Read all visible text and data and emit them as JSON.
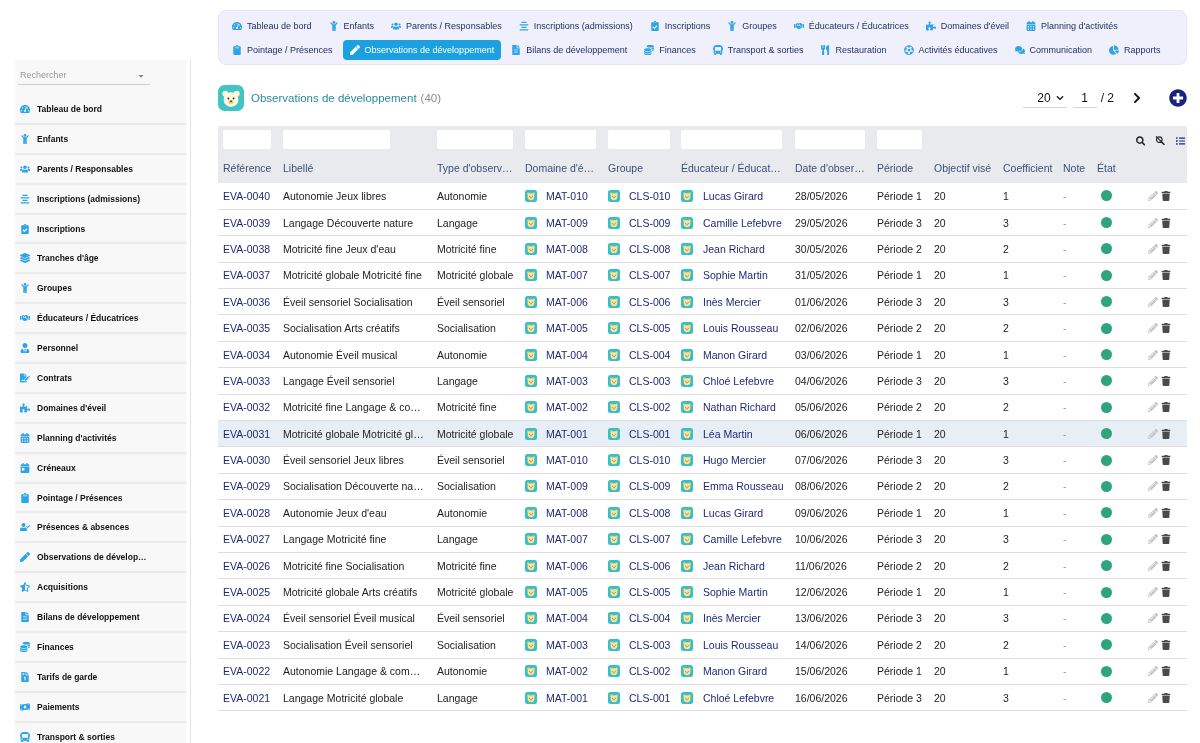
{
  "sidebar": {
    "search": {
      "placeholder": "Rechercher"
    },
    "items": [
      "Tableau de bord",
      "Enfants",
      "Parents / Responsables",
      "Inscriptions (admissions)",
      "Inscriptions",
      "Tranches d'âge",
      "Groupes",
      "Éducateurs / Éducatrices",
      "Personnel",
      "Contrats",
      "Domaines d'éveil",
      "Planning d'activités",
      "Créneaux",
      "Pointage / Présences",
      "Présences & absences",
      "Observations de dévelop…",
      "Acquisitions",
      "Bilans de développement",
      "Finances",
      "Tarifs de garde",
      "Paiements",
      "Transport & sorties"
    ]
  },
  "nav": {
    "tabs": [
      {
        "label": "Tableau de bord",
        "selected": false
      },
      {
        "label": "Enfants",
        "selected": false
      },
      {
        "label": "Parents / Responsables",
        "selected": false
      },
      {
        "label": "Inscriptions (admissions)",
        "selected": false
      },
      {
        "label": "Inscriptions",
        "selected": false
      },
      {
        "label": "Groupes",
        "selected": false
      },
      {
        "label": "Éducateurs / Éducatrices",
        "selected": false
      },
      {
        "label": "Domaines d'éveil",
        "selected": false
      },
      {
        "label": "Planning d'activités",
        "selected": false
      },
      {
        "label": "Pointage / Présences",
        "selected": false
      },
      {
        "label": "Observations de développement",
        "selected": true
      },
      {
        "label": "Bilans de développement",
        "selected": false
      },
      {
        "label": "Finances",
        "selected": false
      },
      {
        "label": "Transport & sorties",
        "selected": false
      },
      {
        "label": "Restauration",
        "selected": false
      },
      {
        "label": "Activités éducatives",
        "selected": false
      },
      {
        "label": "Communication",
        "selected": false
      },
      {
        "label": "Rapports",
        "selected": false
      }
    ]
  },
  "page": {
    "title": "Observations de développement",
    "count": "(40)",
    "page_size": "20",
    "page": "1",
    "page_total": "/ 2"
  },
  "table": {
    "columns": [
      {
        "label": "Référence",
        "filter": true
      },
      {
        "label": "Libellé",
        "filter": true
      },
      {
        "label": "Type d'observ…",
        "filter": true
      },
      {
        "label": "Domaine d'é…",
        "filter": true
      },
      {
        "label": "Groupe",
        "filter": true
      },
      {
        "label": "Éducateur / Éducat…",
        "filter": true
      },
      {
        "label": "Date d'obser…",
        "filter": true
      },
      {
        "label": "Période",
        "filter": true
      },
      {
        "label": "Objectif visé",
        "filter": false
      },
      {
        "label": "Coefficient",
        "filter": false
      },
      {
        "label": "Note",
        "filter": false
      },
      {
        "label": "État",
        "filter": false
      }
    ],
    "rows": [
      {
        "reference": "EVA-0040",
        "libelle": "Autonomie Jeux libres",
        "type": "Autonomie",
        "domaine": "MAT-010",
        "groupe": "CLS-010",
        "educateur": "Lucas Girard",
        "date": "28/05/2026",
        "periode": "Période 1",
        "objectif": "20",
        "coefficient": "1",
        "note": "-",
        "active": true,
        "selected": false
      },
      {
        "reference": "EVA-0039",
        "libelle": "Langage Découverte nature",
        "type": "Langage",
        "domaine": "MAT-009",
        "groupe": "CLS-009",
        "educateur": "Camille Lefebvre",
        "date": "29/05/2026",
        "periode": "Période 3",
        "objectif": "20",
        "coefficient": "3",
        "note": "-",
        "active": true,
        "selected": false
      },
      {
        "reference": "EVA-0038",
        "libelle": "Motricité fine Jeux d'eau",
        "type": "Motricité fine",
        "domaine": "MAT-008",
        "groupe": "CLS-008",
        "educateur": "Jean Richard",
        "date": "30/05/2026",
        "periode": "Période 2",
        "objectif": "20",
        "coefficient": "2",
        "note": "-",
        "active": true,
        "selected": false
      },
      {
        "reference": "EVA-0037",
        "libelle": "Motricité globale Motricité fine",
        "type": "Motricité globale",
        "domaine": "MAT-007",
        "groupe": "CLS-007",
        "educateur": "Sophie Martin",
        "date": "31/05/2026",
        "periode": "Période 1",
        "objectif": "20",
        "coefficient": "1",
        "note": "-",
        "active": true,
        "selected": false
      },
      {
        "reference": "EVA-0036",
        "libelle": "Éveil sensoriel Socialisation",
        "type": "Éveil sensoriel",
        "domaine": "MAT-006",
        "groupe": "CLS-006",
        "educateur": "Inès Mercier",
        "date": "01/06/2026",
        "periode": "Période 3",
        "objectif": "20",
        "coefficient": "3",
        "note": "-",
        "active": true,
        "selected": false
      },
      {
        "reference": "EVA-0035",
        "libelle": "Socialisation Arts créatifs",
        "type": "Socialisation",
        "domaine": "MAT-005",
        "groupe": "CLS-005",
        "educateur": "Louis Rousseau",
        "date": "02/06/2026",
        "periode": "Période 2",
        "objectif": "20",
        "coefficient": "2",
        "note": "-",
        "active": true,
        "selected": false
      },
      {
        "reference": "EVA-0034",
        "libelle": "Autonomie Éveil musical",
        "type": "Autonomie",
        "domaine": "MAT-004",
        "groupe": "CLS-004",
        "educateur": "Manon Girard",
        "date": "03/06/2026",
        "periode": "Période 1",
        "objectif": "20",
        "coefficient": "1",
        "note": "-",
        "active": true,
        "selected": false
      },
      {
        "reference": "EVA-0033",
        "libelle": "Langage Éveil sensoriel",
        "type": "Langage",
        "domaine": "MAT-003",
        "groupe": "CLS-003",
        "educateur": "Chloé Lefebvre",
        "date": "04/06/2026",
        "periode": "Période 3",
        "objectif": "20",
        "coefficient": "3",
        "note": "-",
        "active": true,
        "selected": false
      },
      {
        "reference": "EVA-0032",
        "libelle": "Motricité fine Langage & co…",
        "type": "Motricité fine",
        "domaine": "MAT-002",
        "groupe": "CLS-002",
        "educateur": "Nathan Richard",
        "date": "05/06/2026",
        "periode": "Période 2",
        "objectif": "20",
        "coefficient": "2",
        "note": "-",
        "active": true,
        "selected": false
      },
      {
        "reference": "EVA-0031",
        "libelle": "Motricité globale Motricité gl…",
        "type": "Motricité globale",
        "domaine": "MAT-001",
        "groupe": "CLS-001",
        "educateur": "Léa Martin",
        "date": "06/06/2026",
        "periode": "Période 1",
        "objectif": "20",
        "coefficient": "1",
        "note": "-",
        "active": true,
        "selected": true
      },
      {
        "reference": "EVA-0030",
        "libelle": "Éveil sensoriel Jeux libres",
        "type": "Éveil sensoriel",
        "domaine": "MAT-010",
        "groupe": "CLS-010",
        "educateur": "Hugo Mercier",
        "date": "07/06/2026",
        "periode": "Période 3",
        "objectif": "20",
        "coefficient": "3",
        "note": "-",
        "active": true,
        "selected": false
      },
      {
        "reference": "EVA-0029",
        "libelle": "Socialisation Découverte na…",
        "type": "Socialisation",
        "domaine": "MAT-009",
        "groupe": "CLS-009",
        "educateur": "Emma Rousseau",
        "date": "08/06/2026",
        "periode": "Période 2",
        "objectif": "20",
        "coefficient": "2",
        "note": "-",
        "active": true,
        "selected": false
      },
      {
        "reference": "EVA-0028",
        "libelle": "Autonomie Jeux d'eau",
        "type": "Autonomie",
        "domaine": "MAT-008",
        "groupe": "CLS-008",
        "educateur": "Lucas Girard",
        "date": "09/06/2026",
        "periode": "Période 1",
        "objectif": "20",
        "coefficient": "1",
        "note": "-",
        "active": true,
        "selected": false
      },
      {
        "reference": "EVA-0027",
        "libelle": "Langage Motricité fine",
        "type": "Langage",
        "domaine": "MAT-007",
        "groupe": "CLS-007",
        "educateur": "Camille Lefebvre",
        "date": "10/06/2026",
        "periode": "Période 3",
        "objectif": "20",
        "coefficient": "3",
        "note": "-",
        "active": true,
        "selected": false
      },
      {
        "reference": "EVA-0026",
        "libelle": "Motricité fine Socialisation",
        "type": "Motricité fine",
        "domaine": "MAT-006",
        "groupe": "CLS-006",
        "educateur": "Jean Richard",
        "date": "11/06/2026",
        "periode": "Période 2",
        "objectif": "20",
        "coefficient": "2",
        "note": "-",
        "active": true,
        "selected": false
      },
      {
        "reference": "EVA-0025",
        "libelle": "Motricité globale Arts créatifs",
        "type": "Motricité globale",
        "domaine": "MAT-005",
        "groupe": "CLS-005",
        "educateur": "Sophie Martin",
        "date": "12/06/2026",
        "periode": "Période 1",
        "objectif": "20",
        "coefficient": "1",
        "note": "-",
        "active": true,
        "selected": false
      },
      {
        "reference": "EVA-0024",
        "libelle": "Éveil sensoriel Éveil musical",
        "type": "Éveil sensoriel",
        "domaine": "MAT-004",
        "groupe": "CLS-004",
        "educateur": "Inès Mercier",
        "date": "13/06/2026",
        "periode": "Période 3",
        "objectif": "20",
        "coefficient": "3",
        "note": "-",
        "active": true,
        "selected": false
      },
      {
        "reference": "EVA-0023",
        "libelle": "Socialisation Éveil sensoriel",
        "type": "Socialisation",
        "domaine": "MAT-003",
        "groupe": "CLS-003",
        "educateur": "Louis Rousseau",
        "date": "14/06/2026",
        "periode": "Période 2",
        "objectif": "20",
        "coefficient": "2",
        "note": "-",
        "active": true,
        "selected": false
      },
      {
        "reference": "EVA-0022",
        "libelle": "Autonomie Langage & com…",
        "type": "Autonomie",
        "domaine": "MAT-002",
        "groupe": "CLS-002",
        "educateur": "Manon Girard",
        "date": "15/06/2026",
        "periode": "Période 1",
        "objectif": "20",
        "coefficient": "1",
        "note": "-",
        "active": true,
        "selected": false
      },
      {
        "reference": "EVA-0021",
        "libelle": "Langage Motricité globale",
        "type": "Langage",
        "domaine": "MAT-001",
        "groupe": "CLS-001",
        "educateur": "Chloé Lefebvre",
        "date": "16/06/2026",
        "periode": "Période 3",
        "objectif": "20",
        "coefficient": "3",
        "note": "-",
        "active": true,
        "selected": false
      }
    ]
  }
}
